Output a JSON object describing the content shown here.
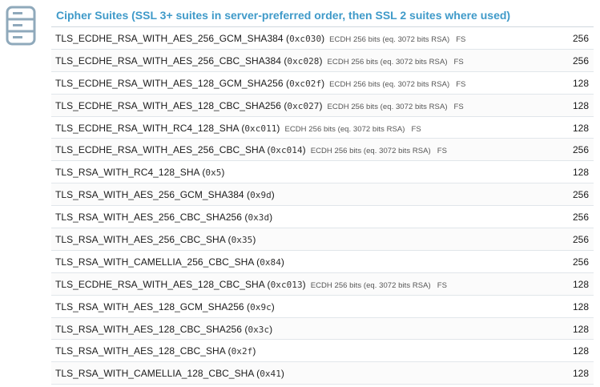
{
  "section": {
    "icon": "server-list-icon",
    "title": "Cipher Suites (SSL 3+ suites in server-preferred order, then SSL 2 suites where used)"
  },
  "colors": {
    "title": "#3f9ac9",
    "icon": "#8fa9bb",
    "row_border": "#e1e6ea"
  },
  "rows": [
    {
      "suite": "TLS_ECDHE_RSA_WITH_AES_256_GCM_SHA384",
      "hex": "0xc030",
      "detail": "ECDH 256 bits (eq. 3072 bits RSA)",
      "fs": "FS",
      "bits": "256"
    },
    {
      "suite": "TLS_ECDHE_RSA_WITH_AES_256_CBC_SHA384",
      "hex": "0xc028",
      "detail": "ECDH 256 bits (eq. 3072 bits RSA)",
      "fs": "FS",
      "bits": "256"
    },
    {
      "suite": "TLS_ECDHE_RSA_WITH_AES_128_GCM_SHA256",
      "hex": "0xc02f",
      "detail": "ECDH 256 bits (eq. 3072 bits RSA)",
      "fs": "FS",
      "bits": "128"
    },
    {
      "suite": "TLS_ECDHE_RSA_WITH_AES_128_CBC_SHA256",
      "hex": "0xc027",
      "detail": "ECDH 256 bits (eq. 3072 bits RSA)",
      "fs": "FS",
      "bits": "128"
    },
    {
      "suite": "TLS_ECDHE_RSA_WITH_RC4_128_SHA",
      "hex": "0xc011",
      "detail": "ECDH 256 bits (eq. 3072 bits RSA)",
      "fs": "FS",
      "bits": "128"
    },
    {
      "suite": "TLS_ECDHE_RSA_WITH_AES_256_CBC_SHA",
      "hex": "0xc014",
      "detail": "ECDH 256 bits (eq. 3072 bits RSA)",
      "fs": "FS",
      "bits": "256"
    },
    {
      "suite": "TLS_RSA_WITH_RC4_128_SHA",
      "hex": "0x5",
      "detail": "",
      "fs": "",
      "bits": "128"
    },
    {
      "suite": "TLS_RSA_WITH_AES_256_GCM_SHA384",
      "hex": "0x9d",
      "detail": "",
      "fs": "",
      "bits": "256"
    },
    {
      "suite": "TLS_RSA_WITH_AES_256_CBC_SHA256",
      "hex": "0x3d",
      "detail": "",
      "fs": "",
      "bits": "256"
    },
    {
      "suite": "TLS_RSA_WITH_AES_256_CBC_SHA",
      "hex": "0x35",
      "detail": "",
      "fs": "",
      "bits": "256"
    },
    {
      "suite": "TLS_RSA_WITH_CAMELLIA_256_CBC_SHA",
      "hex": "0x84",
      "detail": "",
      "fs": "",
      "bits": "256"
    },
    {
      "suite": "TLS_ECDHE_RSA_WITH_AES_128_CBC_SHA",
      "hex": "0xc013",
      "detail": "ECDH 256 bits (eq. 3072 bits RSA)",
      "fs": "FS",
      "bits": "128"
    },
    {
      "suite": "TLS_RSA_WITH_AES_128_GCM_SHA256",
      "hex": "0x9c",
      "detail": "",
      "fs": "",
      "bits": "128"
    },
    {
      "suite": "TLS_RSA_WITH_AES_128_CBC_SHA256",
      "hex": "0x3c",
      "detail": "",
      "fs": "",
      "bits": "128"
    },
    {
      "suite": "TLS_RSA_WITH_AES_128_CBC_SHA",
      "hex": "0x2f",
      "detail": "",
      "fs": "",
      "bits": "128"
    },
    {
      "suite": "TLS_RSA_WITH_CAMELLIA_128_CBC_SHA",
      "hex": "0x41",
      "detail": "",
      "fs": "",
      "bits": "128"
    }
  ]
}
